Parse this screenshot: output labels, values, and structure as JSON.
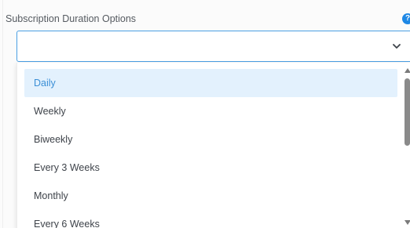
{
  "field": {
    "label": "Subscription Duration Options",
    "help_icon": "question-circle-icon",
    "help_glyph": "?",
    "selected_value": "",
    "chevron_icon": "chevron-down-icon"
  },
  "dropdown": {
    "options": [
      {
        "label": "Daily",
        "highlighted": true
      },
      {
        "label": "Weekly",
        "highlighted": false
      },
      {
        "label": "Biweekly",
        "highlighted": false
      },
      {
        "label": "Every 3 Weeks",
        "highlighted": false
      },
      {
        "label": "Monthly",
        "highlighted": false
      },
      {
        "label": "Every 6 Weeks",
        "highlighted": false
      }
    ]
  },
  "colors": {
    "accent": "#1e88e5",
    "focus_border": "#4a9fe3",
    "highlight_bg": "#e3f1fd",
    "highlight_text": "#3b8fd6",
    "text": "#3e434a"
  }
}
